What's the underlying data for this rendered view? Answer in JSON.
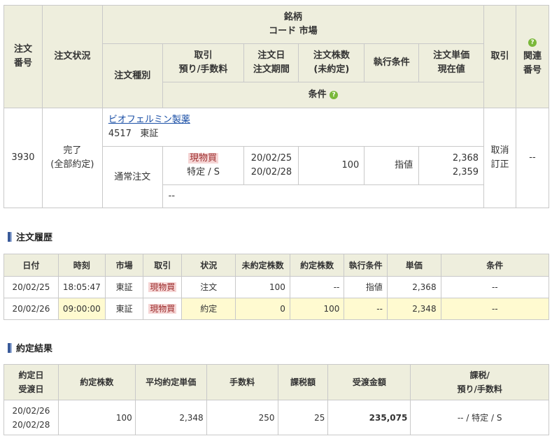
{
  "order": {
    "headers": {
      "order_no_1": "注文",
      "order_no_2": "番号",
      "status": "注文状況",
      "stock_line1": "銘柄",
      "stock_line2": "コード 市場",
      "order_type": "注文種別",
      "trade_1": "取引",
      "trade_2": "預り/手数料",
      "date_1": "注文日",
      "date_2": "注文期間",
      "qty_1": "注文株数",
      "qty_2": "(未約定)",
      "exec_cond": "執行条件",
      "price_1": "注文単価",
      "price_2": "現在値",
      "action": "取引",
      "related_1": "関連",
      "related_2": "番号",
      "condition": "条件",
      "help": "?"
    },
    "row": {
      "order_no": "3930",
      "status_1": "完了",
      "status_2": "(全部約定)",
      "stock_name": "ビオフェルミン製薬",
      "stock_code": "4517",
      "market": "東証",
      "order_type": "通常注文",
      "trade": "現物買",
      "account": "特定 / S",
      "order_date": "20/02/25",
      "period": "20/02/28",
      "qty": "100",
      "exec_cond": "指値",
      "price": "2,368",
      "current_price": "2,359",
      "action_cancel": "取消",
      "action_modify": "訂正",
      "related": "--",
      "condition": "--"
    }
  },
  "history": {
    "title": "注文履歴",
    "headers": [
      "日付",
      "時刻",
      "市場",
      "取引",
      "状況",
      "未約定株数",
      "約定株数",
      "執行条件",
      "単価",
      "条件"
    ],
    "rows": [
      [
        "20/02/25",
        "18:05:47",
        "東証",
        "現物買",
        "注文",
        "100",
        "--",
        "指値",
        "2,368",
        "--"
      ],
      [
        "20/02/26",
        "09:00:00",
        "東証",
        "現物買",
        "約定",
        "0",
        "100",
        "--",
        "2,348",
        "--"
      ]
    ]
  },
  "result": {
    "title": "約定結果",
    "headers": {
      "date_1": "約定日",
      "date_2": "受渡日",
      "qty": "約定株数",
      "avg_price": "平均約定単価",
      "fee": "手数料",
      "tax": "課税額",
      "amount": "受渡金額",
      "taxation_1": "課税/",
      "taxation_2": "預り/手数料"
    },
    "row": {
      "exec_date": "20/02/26",
      "settle_date": "20/02/28",
      "qty": "100",
      "avg_price": "2,348",
      "fee": "250",
      "tax": "25",
      "amount": "235,075",
      "taxation": "-- / 特定 / S"
    }
  },
  "colors": {
    "header_bg": "#eeeedd",
    "highlight_bg": "#fffad0",
    "trade_badge_bg": "#f6d6d6",
    "link": "#1a4fa6",
    "help_icon": "#7ab83a"
  }
}
